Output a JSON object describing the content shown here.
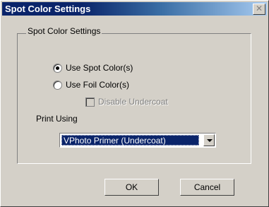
{
  "window": {
    "title": "Spot Color Settings"
  },
  "group": {
    "caption": "Spot Color Settings"
  },
  "options": {
    "use_spot": {
      "label": "Use Spot Color(s)",
      "selected": true
    },
    "use_foil": {
      "label": "Use Foil Color(s)",
      "selected": false
    },
    "disable_undercoat": {
      "label": "Disable Undercoat",
      "checked": false,
      "enabled": false
    }
  },
  "print_using": {
    "label": "Print Using",
    "value": "VPhoto Primer (Undercoat)"
  },
  "buttons": {
    "ok": "OK",
    "cancel": "Cancel"
  }
}
